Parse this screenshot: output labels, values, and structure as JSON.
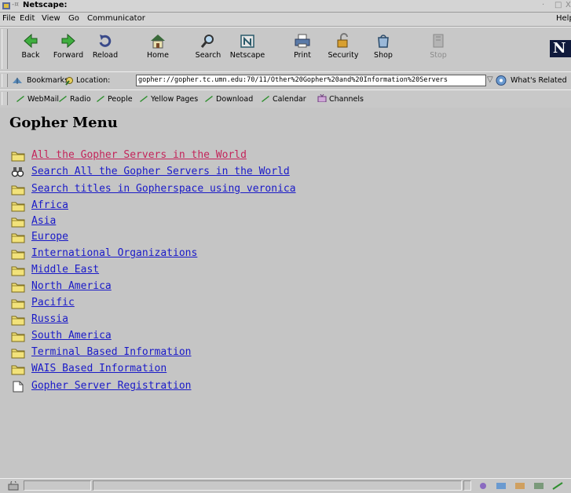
{
  "window": {
    "title": "Netscape:",
    "controls": [
      "·",
      "□",
      "X"
    ]
  },
  "menubar": {
    "items": [
      "File",
      "Edit",
      "View",
      "Go",
      "Communicator"
    ],
    "help": "Help"
  },
  "nav": {
    "buttons": [
      {
        "label": "Back",
        "icon": "back-arrow-icon"
      },
      {
        "label": "Forward",
        "icon": "forward-arrow-icon"
      },
      {
        "label": "Reload",
        "icon": "reload-icon"
      },
      {
        "label": "Home",
        "icon": "home-icon"
      },
      {
        "label": "Search",
        "icon": "search-icon"
      },
      {
        "label": "Netscape",
        "icon": "netscape-icon"
      },
      {
        "label": "Print",
        "icon": "print-icon"
      },
      {
        "label": "Security",
        "icon": "security-lock-icon"
      },
      {
        "label": "Shop",
        "icon": "shop-icon"
      },
      {
        "label": "Stop",
        "icon": "stop-icon"
      }
    ],
    "logo": "N"
  },
  "location": {
    "bookmarks_label": "Bookmarks",
    "location_label": "Location:",
    "url": "gopher://gopher.tc.umn.edu:70/11/Other%20Gopher%20and%20Information%20Servers",
    "whats_related": "What's Related"
  },
  "personal": {
    "items": [
      "WebMail",
      "Radio",
      "People",
      "Yellow Pages",
      "Download",
      "Calendar",
      "Channels"
    ]
  },
  "page": {
    "title": "Gopher Menu",
    "items": [
      {
        "label": "All the Gopher Servers in the World",
        "icon": "folder",
        "visited": true
      },
      {
        "label": "Search All the Gopher Servers in the World",
        "icon": "search",
        "visited": false
      },
      {
        "label": "Search titles in Gopherspace using veronica",
        "icon": "folder",
        "visited": false
      },
      {
        "label": "Africa",
        "icon": "folder",
        "visited": false
      },
      {
        "label": "Asia",
        "icon": "folder",
        "visited": false
      },
      {
        "label": "Europe",
        "icon": "folder",
        "visited": false
      },
      {
        "label": "International Organizations",
        "icon": "folder",
        "visited": false
      },
      {
        "label": "Middle East",
        "icon": "folder",
        "visited": false
      },
      {
        "label": "North America",
        "icon": "folder",
        "visited": false
      },
      {
        "label": "Pacific",
        "icon": "folder",
        "visited": false
      },
      {
        "label": "Russia",
        "icon": "folder",
        "visited": false
      },
      {
        "label": "South America",
        "icon": "folder",
        "visited": false
      },
      {
        "label": "Terminal Based Information",
        "icon": "folder",
        "visited": false
      },
      {
        "label": "WAIS Based Information",
        "icon": "folder",
        "visited": false
      },
      {
        "label": "Gopher Server Registration",
        "icon": "document",
        "visited": false
      }
    ]
  },
  "colors": {
    "link": "#1a1ac8",
    "visited_link": "#c4245a",
    "background": "#c5c5c5"
  }
}
